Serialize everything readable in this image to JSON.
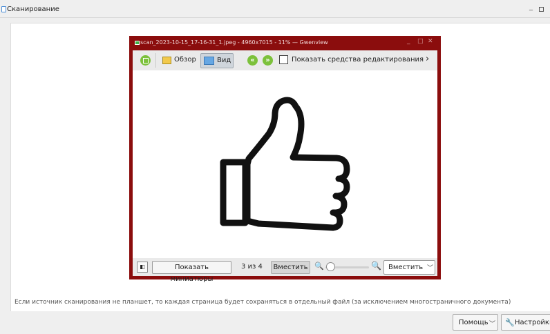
{
  "window": {
    "title": "Сканирование",
    "minimize_glyph": "_"
  },
  "gwenview": {
    "title": "scan_2023-10-15_17-16-31_1.jpeg - 4960x7015 - 11% — Gwenview",
    "controls": [
      "_",
      "□",
      "✕"
    ],
    "toolbar": {
      "browse_label": "Обзор",
      "view_label": "Вид",
      "prev_glyph": "«",
      "next_glyph": "»",
      "edit_label": "Показать средства редактирования",
      "more_glyph": "›"
    },
    "status": {
      "sidebar_glyph": "◧",
      "thumbnails_label": "Показать миниатюры",
      "counter": "3 из 4",
      "fit_label": "Вместить",
      "zoom_select_value": "Вместить",
      "zoom_level": 0
    },
    "image_icon": "thumbs-up-icon",
    "frame_color": "#8b0d0d"
  },
  "info_text": "Если источник сканирования не планшет, то каждая страница будет сохраняться в отдельный файл (за исключением многостраничного документа)",
  "footer": {
    "help_label": "Помощь",
    "settings_label": "Настройки"
  }
}
